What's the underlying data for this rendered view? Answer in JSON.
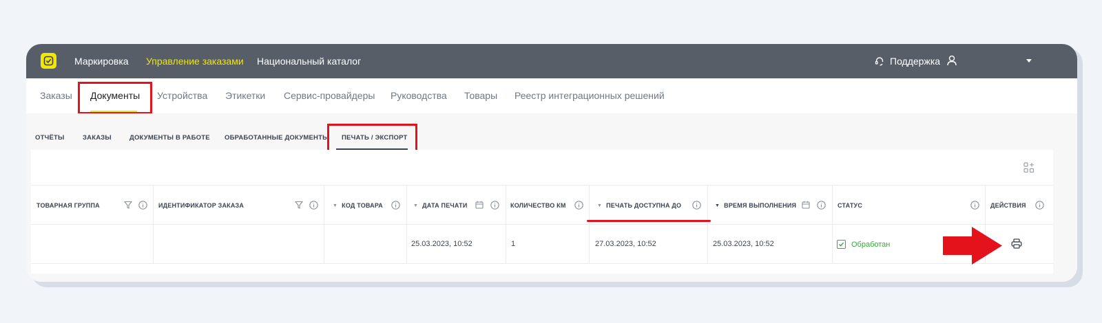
{
  "colors": {
    "topbar": "#575e68",
    "accent": "#f3e600",
    "highlight": "#e3121b",
    "status_ok": "#2eae2e"
  },
  "topbar": {
    "logo_icon": "logo-check-icon",
    "links": [
      "Маркировка",
      "Управление заказами",
      "Национальный каталог"
    ],
    "active_link": "Управление заказами",
    "support_label": "Поддержка"
  },
  "mainnav": {
    "items": [
      "Заказы",
      "Документы",
      "Устройства",
      "Этикетки",
      "Сервис-провайдеры",
      "Руководства",
      "Товары",
      "Реестр интеграционных решений"
    ],
    "active": "Документы"
  },
  "subtabs": {
    "items": [
      "ОТЧЁТЫ",
      "ЗАКАЗЫ",
      "ДОКУМЕНТЫ В РАБОТЕ",
      "ОБРАБОТАННЫЕ ДОКУМЕНТЫ",
      "ПЕЧАТЬ / ЭКСПОРТ"
    ],
    "active": "ПЕЧАТЬ / ЭКСПОРТ"
  },
  "table": {
    "headers": [
      "ТОВАРНАЯ ГРУППА",
      "ИДЕНТИФИКАТОР ЗАКАЗА",
      "КОД ТОВАРА",
      "ДАТА ПЕЧАТИ",
      "КОЛИЧЕСТВО КМ",
      "ПЕЧАТЬ ДОСТУПНА ДО",
      "ВРЕМЯ ВЫПОЛНЕНИЯ",
      "СТАТУС",
      "ДЕЙСТВИЯ"
    ],
    "rows": [
      {
        "group": "",
        "order_id": "",
        "code": "",
        "print_date": "25.03.2023, 10:52",
        "km_count": "1",
        "available_until": "27.03.2023, 10:52",
        "completion_time": "25.03.2023, 10:52",
        "status": "Обработан"
      }
    ]
  }
}
